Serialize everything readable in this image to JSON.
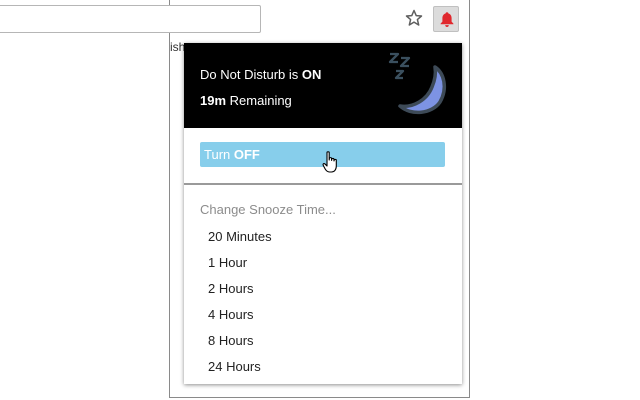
{
  "browser": {
    "bookmark_fragment": "ish",
    "bookmark_star_icon": "star-outline-icon",
    "extension_icon": "bell-icon",
    "extension_icon_color": "#e0282e"
  },
  "popup": {
    "status": {
      "prefix": "Do Not Disturb is ",
      "state": "ON",
      "remaining_value": "19m",
      "remaining_suffix": " Remaining",
      "art_icon": "sleeping-moon-icon"
    },
    "toggle_button": {
      "prefix": "Turn ",
      "action": "OFF",
      "color": "#87ceeb"
    },
    "snooze": {
      "heading": "Change Snooze Time...",
      "options": [
        "20 Minutes",
        "1 Hour",
        "2 Hours",
        "4 Hours",
        "8 Hours",
        "24 Hours"
      ]
    }
  }
}
